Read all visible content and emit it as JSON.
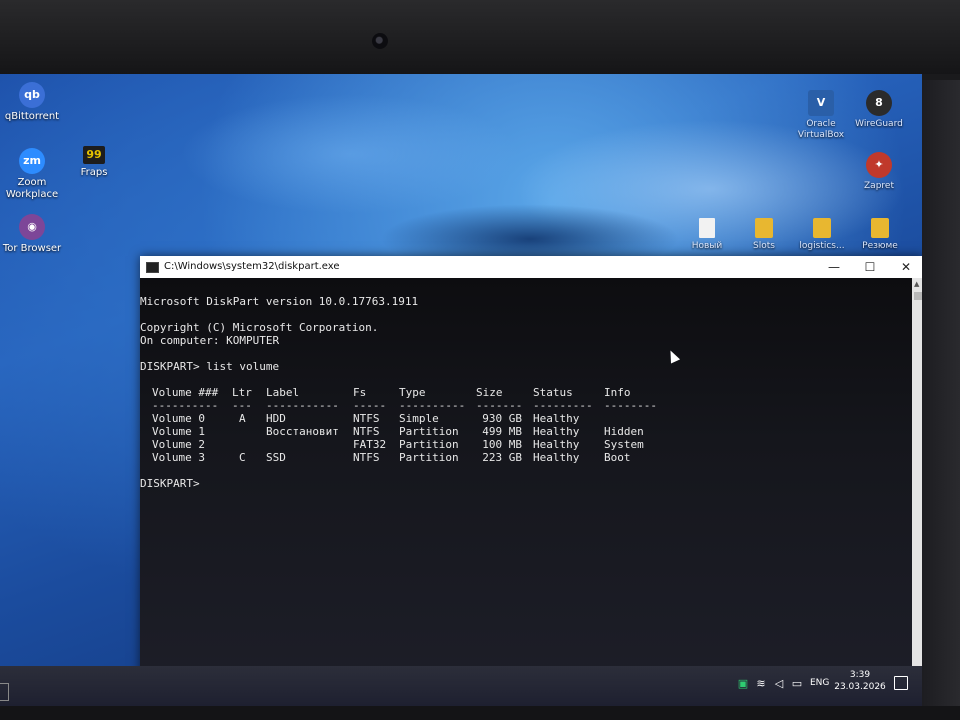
{
  "desktop": {
    "icons_left": [
      {
        "label": "qBittorrent",
        "glyph": "qb",
        "color": "#3b6fd6"
      },
      {
        "label": "Zoom\nWorkplace",
        "glyph": "zm",
        "color": "#2d8cff"
      },
      {
        "label": "Fraps",
        "glyph": "99",
        "color": "#e6c200"
      },
      {
        "label": "Tor Browser",
        "glyph": "◉",
        "color": "#7d4698"
      }
    ],
    "icons_right": [
      {
        "label": "Oracle\nVirtualBox",
        "glyph": "V",
        "color": "#2a5fa8"
      },
      {
        "label": "WireGuard",
        "glyph": "8",
        "color": "#2b2b2b"
      },
      {
        "label": "Zapret",
        "glyph": "✦",
        "color": "#c0392b"
      }
    ],
    "icons_files": [
      {
        "label": "Новый"
      },
      {
        "label": "Slots"
      },
      {
        "label": "logistics..."
      },
      {
        "label": "Резюме"
      }
    ]
  },
  "console": {
    "title": "C:\\Windows\\system32\\diskpart.exe",
    "lines": [
      "Microsoft DiskPart version 10.0.17763.1911",
      "Copyright (C) Microsoft Corporation.",
      "On computer: KOMPUTER",
      "DISKPART> list volume",
      "DISKPART>"
    ],
    "table": {
      "headers": [
        "Volume ###",
        "Ltr",
        "Label",
        "Fs",
        "Type",
        "Size",
        "Status",
        "Info"
      ],
      "separators": [
        "----------",
        "---",
        "-----------",
        "-----",
        "----------",
        "-------",
        "---------",
        "--------"
      ],
      "rows": [
        [
          "Volume 0",
          "A",
          "HDD",
          "NTFS",
          "Simple",
          "930 GB",
          "Healthy",
          ""
        ],
        [
          "Volume 1",
          "",
          "Восстановит",
          "NTFS",
          "Partition",
          "499 MB",
          "Healthy",
          "Hidden"
        ],
        [
          "Volume 2",
          "",
          "",
          "FAT32",
          "Partition",
          "100 MB",
          "Healthy",
          "System"
        ],
        [
          "Volume 3",
          "C",
          "SSD",
          "NTFS",
          "Partition",
          "223 GB",
          "Healthy",
          "Boot"
        ]
      ]
    }
  },
  "taskbar": {
    "language": "ENG",
    "time": "3:39",
    "date": "23.03.2026"
  }
}
